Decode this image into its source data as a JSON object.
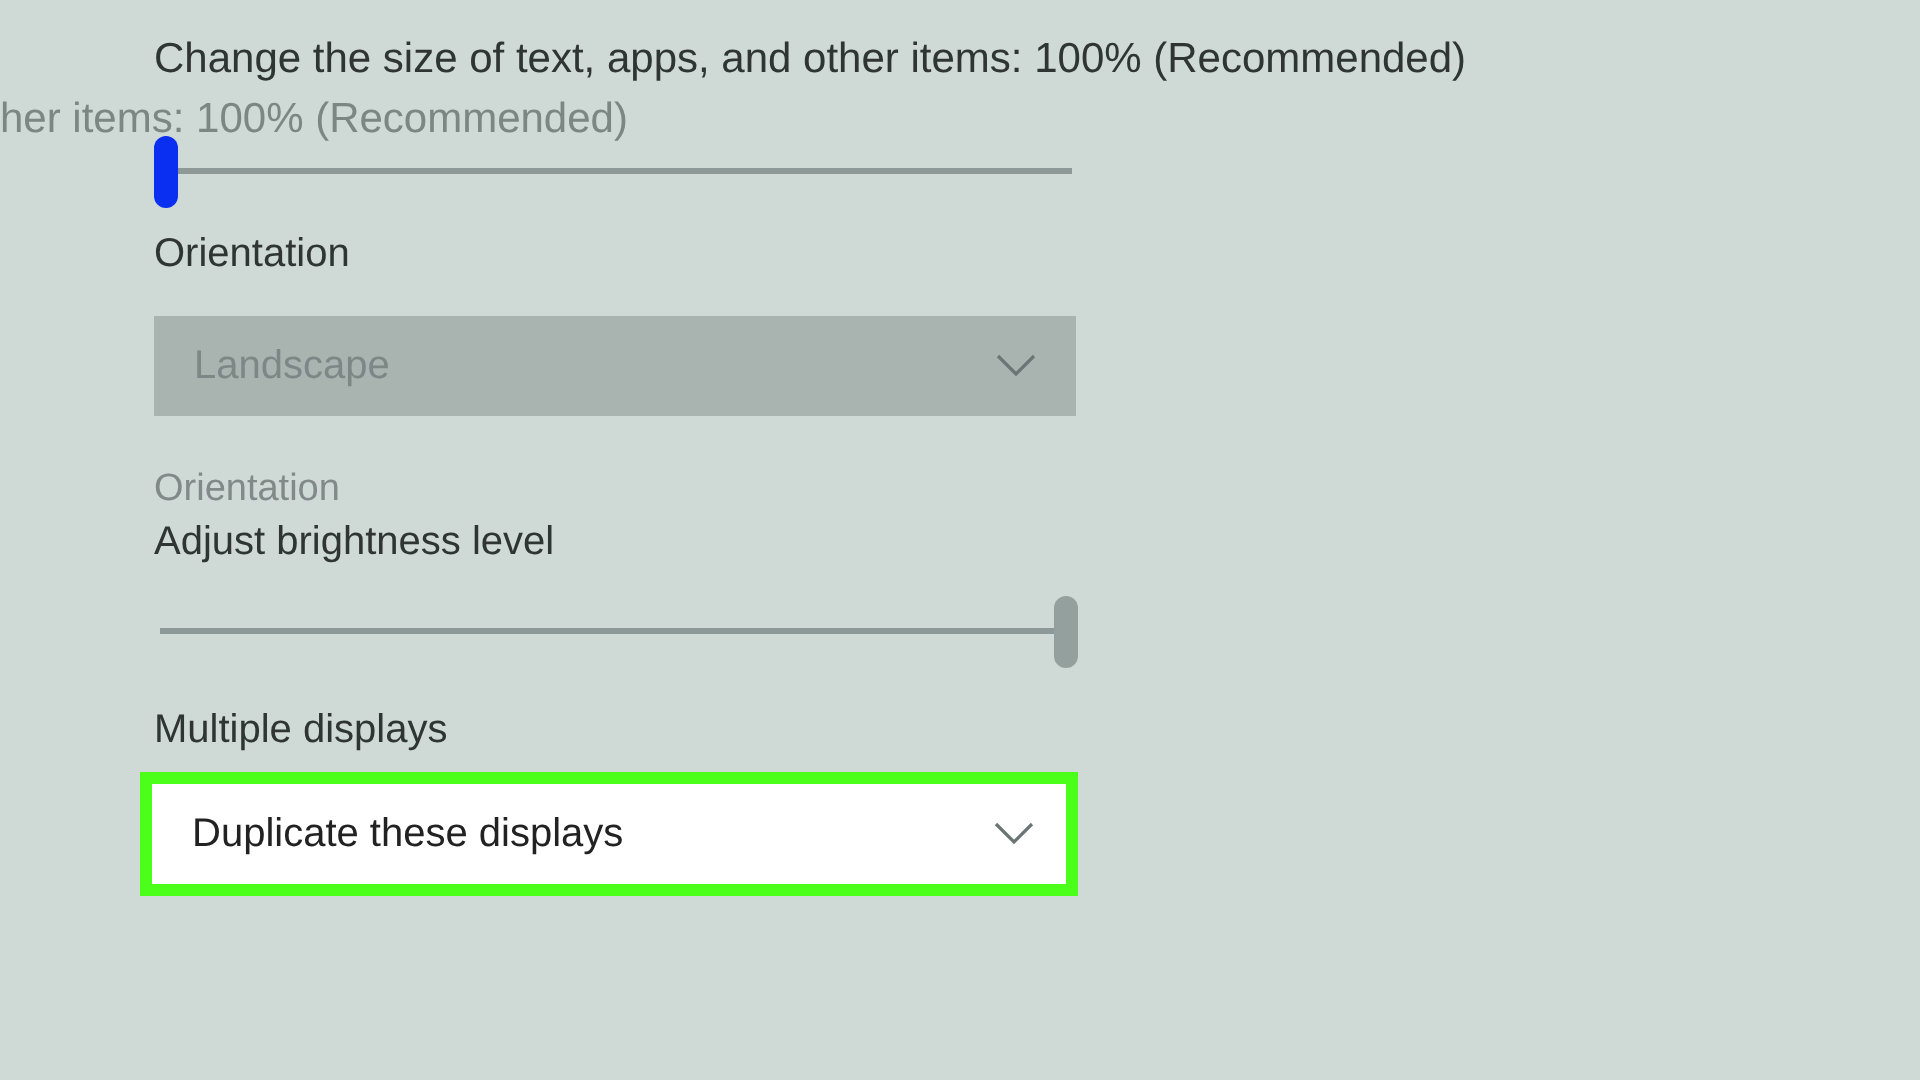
{
  "scale": {
    "label": "Change the size of text, apps, and other items: 100% (Recommended)",
    "ghost": "her items: 100% (Recommended)",
    "level": 0
  },
  "orientation": {
    "label": "Orientation",
    "value": "Landscape",
    "disabled": true,
    "ghost": "Orientation"
  },
  "brightness": {
    "label": "Adjust brightness level",
    "level": 1
  },
  "multiple_displays": {
    "label": "Multiple displays",
    "value": "Duplicate these displays",
    "highlighted": true
  }
}
